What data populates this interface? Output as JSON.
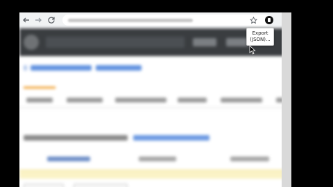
{
  "browser": {
    "nav": {
      "back_icon": "arrow-left-icon",
      "forward_icon": "arrow-right-icon",
      "reload_icon": "reload-icon"
    },
    "bookmark_icon": "star-icon",
    "extension_icon": "download-circle-icon"
  },
  "tooltip": {
    "line1": "Export",
    "line2": "(JSON)..."
  },
  "colors": {
    "header_bg": "#3a3d40",
    "link_blue": "#2f6fd6",
    "accent_orange": "#f0a030",
    "notice_yellow": "#fbf3c6"
  }
}
